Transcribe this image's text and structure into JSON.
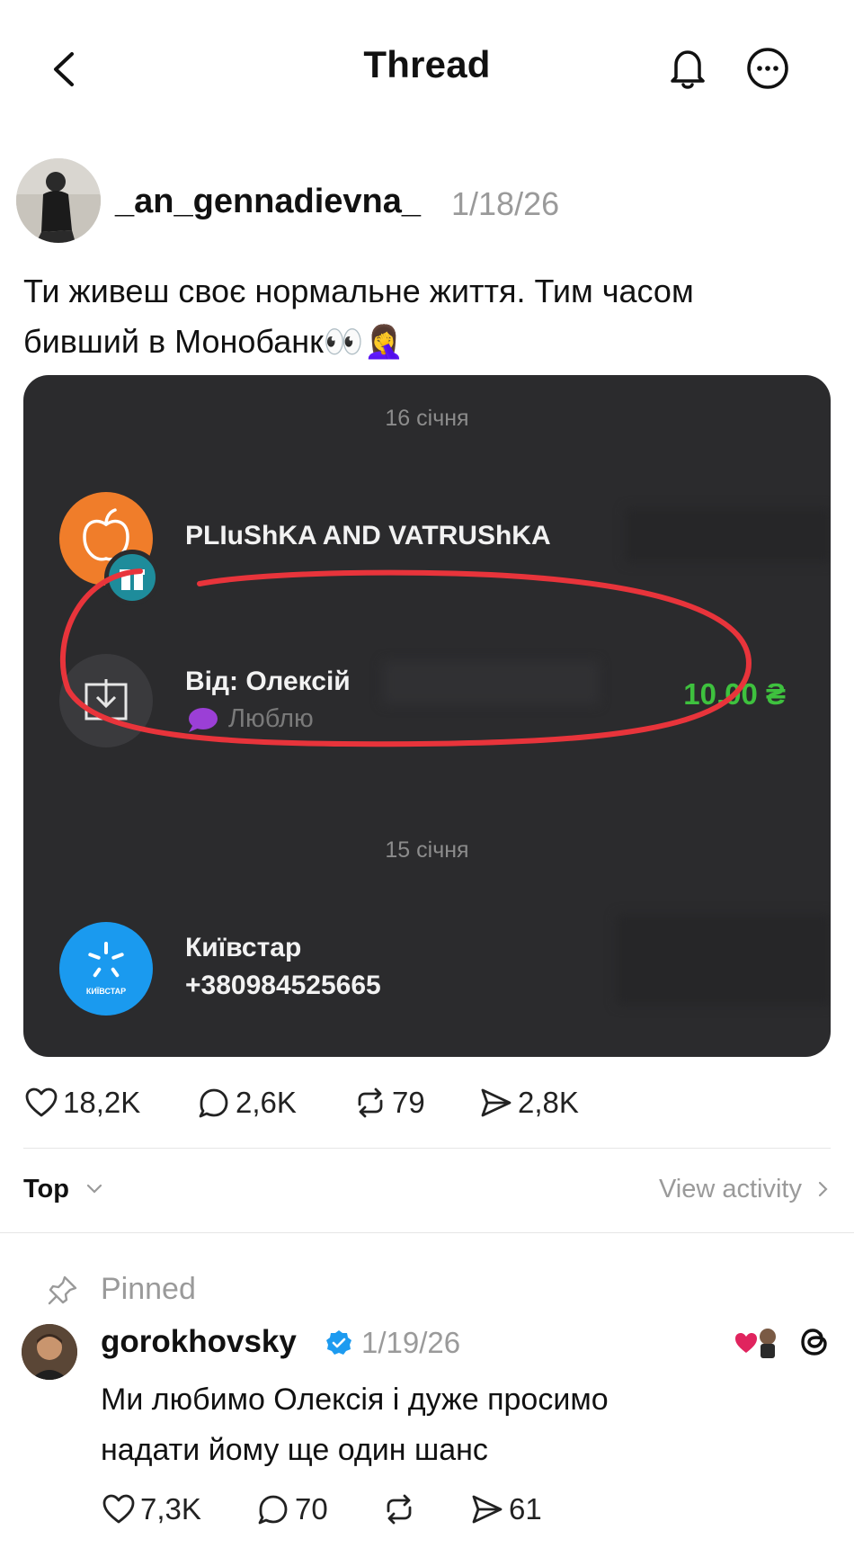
{
  "header": {
    "title": "Thread",
    "back_icon": "chevron-left-icon",
    "bell_icon": "bell-icon",
    "more_icon": "more-horizontal-icon"
  },
  "post": {
    "author": "_an_gennadievna_",
    "date": "1/18/26",
    "text_line1": "Ти живеш своє нормальне життя. Тим часом",
    "text_line2": "бивший в Монобанк👀🤦‍♀️",
    "card": {
      "date1": "16 січня",
      "merchant": "PLIuShKA AND VATRUShKA",
      "sender": "Від: Олексій",
      "sender_extra": "ˈ ¨",
      "message": "Люблю",
      "amount": "10.00 ₴",
      "date2": "15 січня",
      "contact_name": "Київстар",
      "contact_phone": "+380984525665",
      "kyivstar_logo_text": "КИЇВСТАР",
      "highlight_color": "#e8343b",
      "amount_color": "#3ec13e"
    },
    "stats": {
      "likes": "18,2K",
      "comments": "2,6K",
      "reposts": "79",
      "shares": "2,8K"
    }
  },
  "sort": {
    "label": "Top",
    "view_activity": "View activity"
  },
  "pinned_comment": {
    "pinned_label": "Pinned",
    "author": "gorokhovsky",
    "date": "1/19/26",
    "text_line1": "Ми любимо Олексія і дуже просимо",
    "text_line2": "надати йому ще один шанс",
    "stats": {
      "likes": "7,3K",
      "comments": "70",
      "shares": "61"
    },
    "verified_color": "#1d9bf0"
  }
}
